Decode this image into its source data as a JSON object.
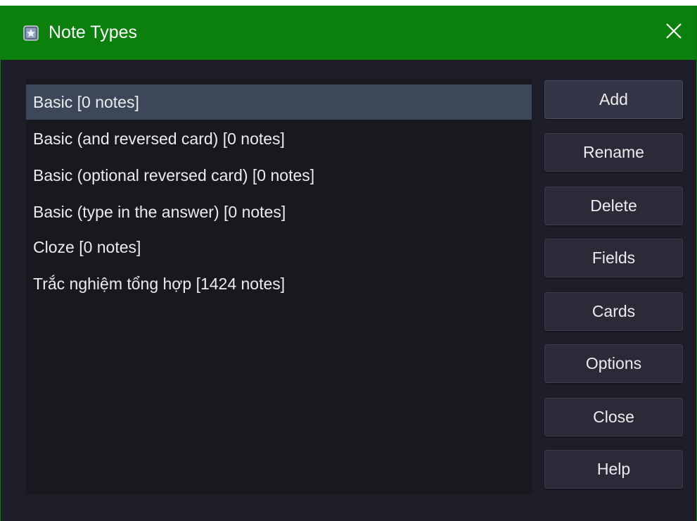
{
  "window": {
    "title": "Note Types",
    "colors": {
      "titlebar": "#0c800c",
      "background": "#1e1e2b",
      "list_background": "#18181f",
      "selected_row": "#3c4859"
    }
  },
  "note_types": [
    {
      "label": "Basic [0 notes]",
      "selected": true
    },
    {
      "label": "Basic (and reversed card) [0 notes]",
      "selected": false
    },
    {
      "label": "Basic (optional reversed card) [0 notes]",
      "selected": false
    },
    {
      "label": "Basic (type in the answer) [0 notes]",
      "selected": false
    },
    {
      "label": "Cloze [0 notes]",
      "selected": false
    },
    {
      "label": "Trắc nghiệm tổng hợp [1424 notes]",
      "selected": false
    }
  ],
  "buttons": {
    "add": "Add",
    "rename": "Rename",
    "delete": "Delete",
    "fields": "Fields",
    "cards": "Cards",
    "options": "Options",
    "close": "Close",
    "help": "Help"
  }
}
